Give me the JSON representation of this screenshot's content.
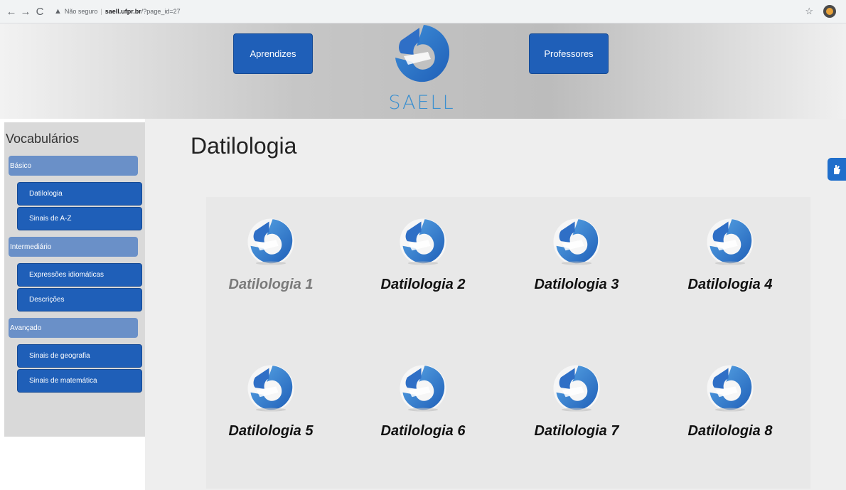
{
  "browser": {
    "security_label": "Não seguro",
    "host": "saell.ufpr.br",
    "path": "/?page_id=27",
    "warning_icon": "warning-triangle-icon"
  },
  "header": {
    "left_button": "Aprendizes",
    "right_button": "Professores",
    "logo_text": "SAELL",
    "logo_color": "#3a8fd0",
    "button_color": "#1f5fb8"
  },
  "sidebar": {
    "title": "Vocabulários",
    "levels": [
      {
        "label": "Básico",
        "items": [
          "Datilologia",
          "Sinais de A-Z"
        ]
      },
      {
        "label": "Intermediário",
        "items": [
          "Expressões idiomáticas",
          "Descrições"
        ]
      },
      {
        "label": "Avançado",
        "items": [
          "Sinais de geografia",
          "Sinais de matemática"
        ]
      }
    ]
  },
  "main": {
    "title": "Datilologia",
    "cards": [
      {
        "label": "Datilologia 1"
      },
      {
        "label": "Datilologia 2"
      },
      {
        "label": "Datilologia 3"
      },
      {
        "label": "Datilologia 4"
      },
      {
        "label": "Datilologia 5"
      },
      {
        "label": "Datilologia 6"
      },
      {
        "label": "Datilologia 7"
      },
      {
        "label": "Datilologia 8"
      }
    ]
  }
}
